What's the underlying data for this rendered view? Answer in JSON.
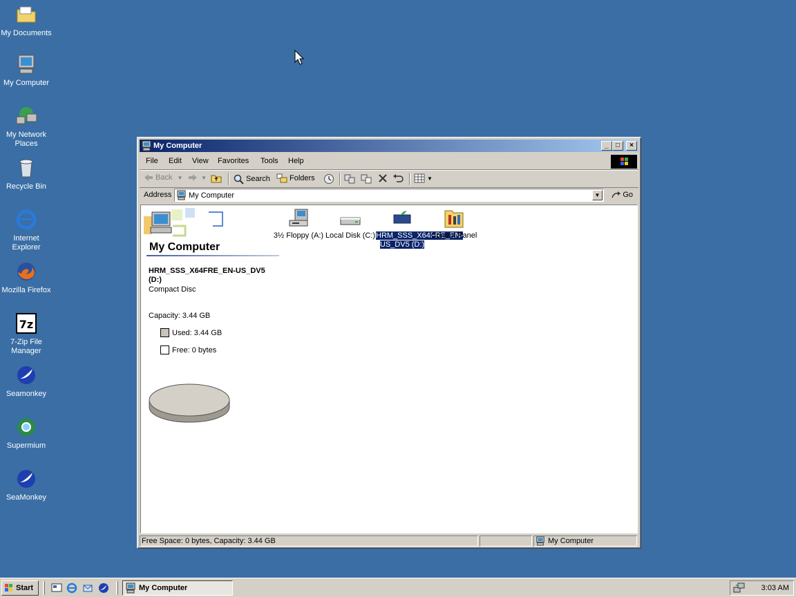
{
  "desktop": {
    "icons": [
      {
        "label": "My Documents",
        "icon": "folder-icon"
      },
      {
        "label": "My Computer",
        "icon": "computer-icon"
      },
      {
        "label": "My Network Places",
        "icon": "network-icon"
      },
      {
        "label": "Recycle Bin",
        "icon": "recycle-bin-icon"
      },
      {
        "label": "Internet Explorer",
        "icon": "ie-icon"
      },
      {
        "label": "Mozilla Firefox",
        "icon": "firefox-icon"
      },
      {
        "label": "7-Zip File Manager",
        "icon": "7zip-icon"
      },
      {
        "label": "Seamonkey",
        "icon": "seamonkey-icon"
      },
      {
        "label": "Supermium",
        "icon": "supermium-icon"
      },
      {
        "label": "SeaMonkey",
        "icon": "seamonkey-icon"
      }
    ]
  },
  "window": {
    "title": "My Computer",
    "menu": [
      "File",
      "Edit",
      "View",
      "Favorites",
      "Tools",
      "Help"
    ],
    "toolbar": {
      "back": "Back",
      "search": "Search",
      "folders": "Folders"
    },
    "address": {
      "label": "Address",
      "value": "My Computer",
      "go": "Go"
    },
    "sidebar": {
      "title": "My Computer",
      "drive_name": "HRM_SSS_X64FRE_EN-US_DV5 (D:)",
      "drive_type": "Compact Disc",
      "capacity": "Capacity: 3.44 GB",
      "used": "Used: 3.44 GB",
      "free": "Free: 0 bytes"
    },
    "items": [
      {
        "label": "3½ Floppy (A:)",
        "icon": "floppy-drive-icon"
      },
      {
        "label": "Local Disk (C:)",
        "icon": "hard-disk-icon"
      },
      {
        "label": "HRM_SSS_X64FRE_EN-US_DV5 (D:)",
        "icon": "cd-drive-icon",
        "selected": true
      },
      {
        "label": "Control Panel",
        "icon": "control-panel-icon"
      }
    ],
    "status": {
      "left": "Free Space: 0 bytes, Capacity: 3.44 GB",
      "right": "My Computer"
    }
  },
  "taskbar": {
    "start": "Start",
    "task": "My Computer",
    "clock": "3:03 AM"
  },
  "colors": {
    "desktop": "#3a6ea5",
    "titlebar": "#0a246a",
    "selection": "#0a246a"
  }
}
